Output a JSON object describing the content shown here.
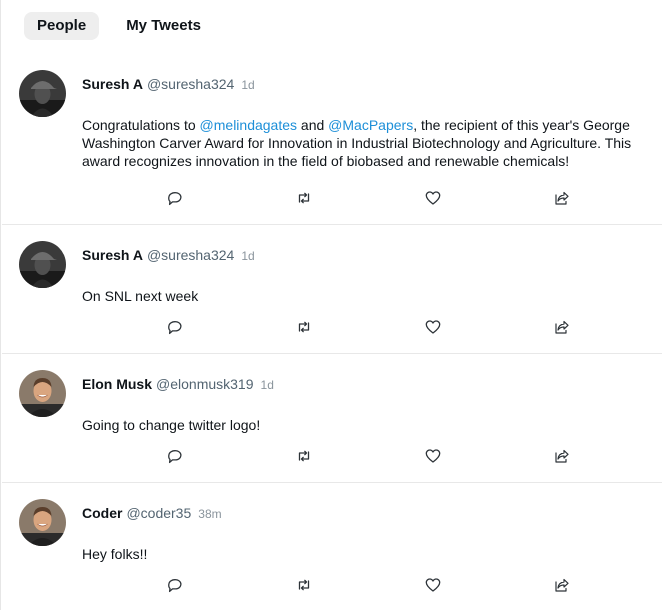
{
  "tabs": [
    {
      "label": "People",
      "active": true
    },
    {
      "label": "My Tweets",
      "active": false
    }
  ],
  "tweets": [
    {
      "name": "Suresh A",
      "handle": "@suresha324",
      "time": "1d",
      "text_parts": [
        "Congratulations to ",
        "@melindagates",
        " and ",
        "@MacPapers",
        ", the recipient of this year's George Washington Carver Award for Innovation in Industrial Biotechnology and Agriculture. This award recognizes innovation in the field of biobased and renewable chemicals!"
      ],
      "avatar": "avatar-cap-woman"
    },
    {
      "name": "Suresh A",
      "handle": "@suresha324",
      "time": "1d",
      "text": "On SNL next week",
      "avatar": "avatar-cap-woman"
    },
    {
      "name": "Elon Musk",
      "handle": "@elonmusk319",
      "time": "1d",
      "text": "Going to change twitter logo!",
      "avatar": "avatar-man-smile"
    },
    {
      "name": "Coder",
      "handle": "@coder35",
      "time": "38m",
      "text": "Hey folks!!",
      "avatar": "avatar-man-smile"
    }
  ],
  "icons": {
    "reply": "reply-icon",
    "retweet": "retweet-icon",
    "like": "heart-icon",
    "share": "share-icon"
  },
  "colors": {
    "mention": "#1d8fd8",
    "handle": "#536471",
    "active_tab_bg": "#eeeeee"
  }
}
